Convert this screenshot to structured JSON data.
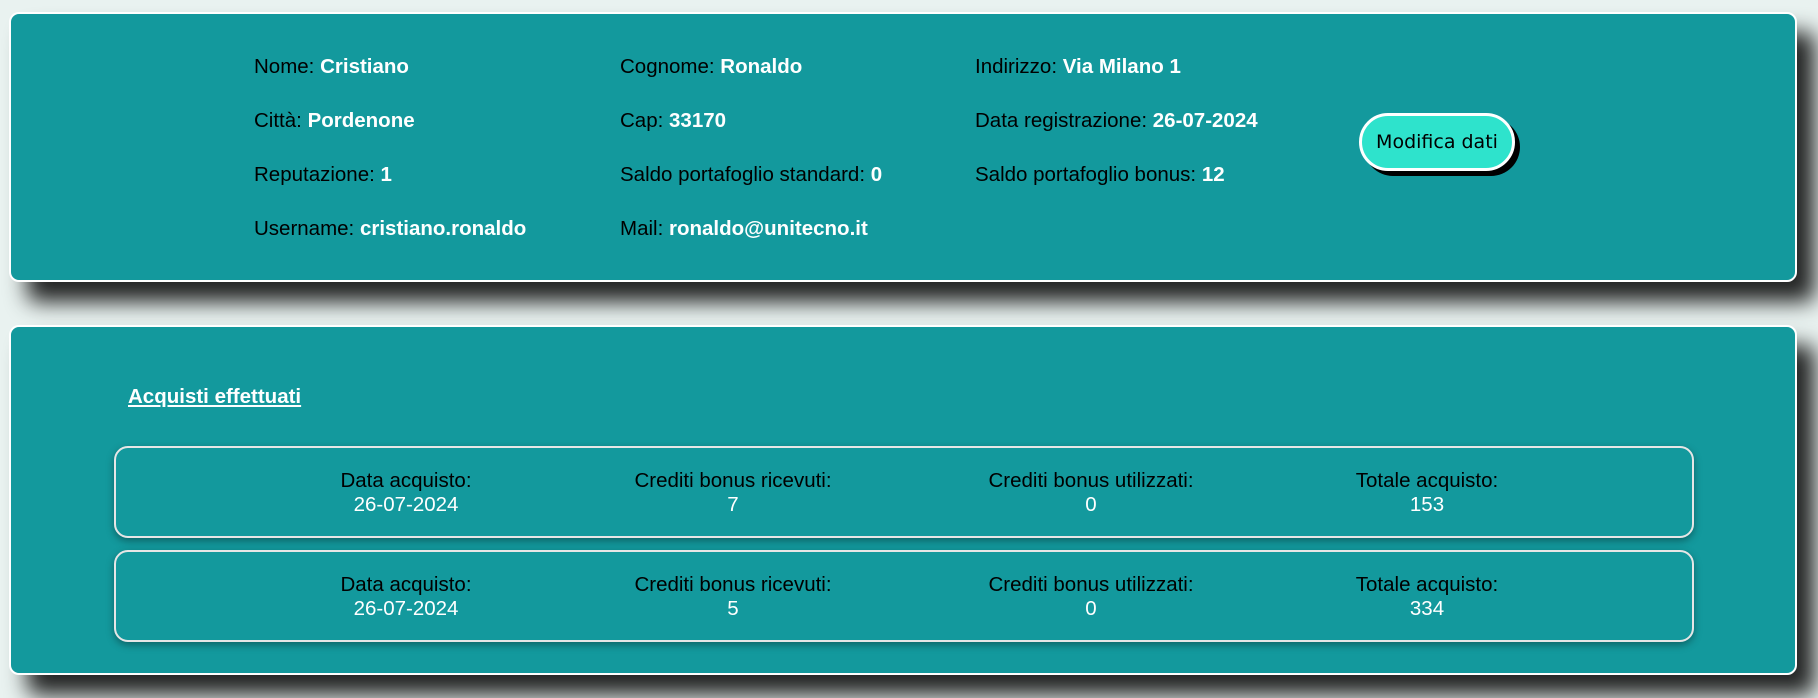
{
  "profile": {
    "nome": {
      "label": "Nome:",
      "value": "Cristiano"
    },
    "cognome": {
      "label": "Cognome:",
      "value": "Ronaldo"
    },
    "indirizzo": {
      "label": "Indirizzo:",
      "value": "Via Milano 1"
    },
    "citta": {
      "label": "Città:",
      "value": "Pordenone"
    },
    "cap": {
      "label": "Cap:",
      "value": "33170"
    },
    "data_registrazione": {
      "label": "Data registrazione:",
      "value": "26-07-2024"
    },
    "reputazione": {
      "label": "Reputazione:",
      "value": "1"
    },
    "saldo_standard": {
      "label": "Saldo portafoglio standard:",
      "value": "0"
    },
    "saldo_bonus": {
      "label": "Saldo portafoglio bonus:",
      "value": "12"
    },
    "username": {
      "label": "Username:",
      "value": "cristiano.ronaldo"
    },
    "mail": {
      "label": "Mail:",
      "value": "ronaldo@unitecno.it"
    },
    "edit_button": "Modifica dati"
  },
  "purchases": {
    "title": "Acquisti effettuati",
    "labels": {
      "date": "Data acquisto:",
      "received": "Crediti bonus ricevuti:",
      "used": "Crediti bonus utilizzati:",
      "total": "Totale acquisto:"
    },
    "items": [
      {
        "date": "26-07-2024",
        "received": "7",
        "used": "0",
        "total": "153"
      },
      {
        "date": "26-07-2024",
        "received": "5",
        "used": "0",
        "total": "334"
      }
    ]
  },
  "colors": {
    "panel": "#13999d",
    "button": "#2ee3cc",
    "page": "#e9f2f0"
  }
}
